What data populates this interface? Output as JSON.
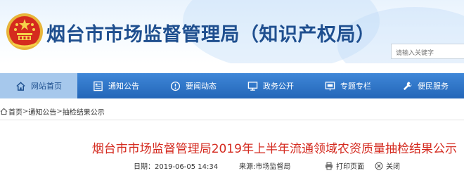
{
  "header": {
    "site_title": "烟台市市场监督管理局（知识产权局）",
    "search_placeholder": "请输入关键字"
  },
  "nav": {
    "items": [
      {
        "label": "网站首页",
        "icon": "home-icon",
        "active": true
      },
      {
        "label": "通知公告",
        "icon": "notice-icon",
        "active": false
      },
      {
        "label": "要闻动态",
        "icon": "news-icon",
        "active": false
      },
      {
        "label": "政务公开",
        "icon": "monitor-icon",
        "active": false
      },
      {
        "label": "专题专栏",
        "icon": "column-icon",
        "active": false
      },
      {
        "label": "便民服务",
        "icon": "wrench-icon",
        "active": false
      }
    ]
  },
  "breadcrumb": {
    "items": [
      "首页",
      "通知公告",
      "抽检结果公示"
    ],
    "separator": ">"
  },
  "article": {
    "title": "烟台市市场监督管理局2019年上半年流通领域农资质量抽检结果公示",
    "date_label": "日期：",
    "date_value": "2019-06-05 14:34",
    "source_label": "来源:",
    "source_value": "市场监督局",
    "print_label": "打印页面",
    "close_label": "关闭"
  },
  "colors": {
    "nav_blue": "#2f78cc",
    "nav_active": "#a6c8ec",
    "title_blue": "#1f4f8f",
    "article_red": "#d42a1f"
  }
}
